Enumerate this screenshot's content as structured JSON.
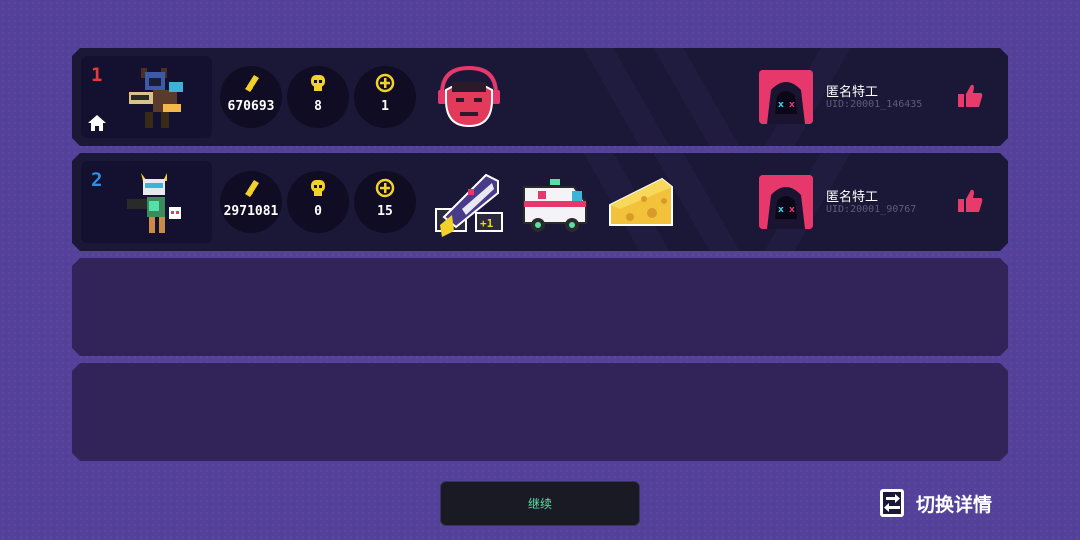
{
  "rows": [
    {
      "rank": "1",
      "rank_color": "#e33a3a",
      "is_self": true,
      "stats": {
        "bullets": "670693",
        "kills": "8",
        "coins": "1"
      },
      "items": [
        "devil-mask-item"
      ],
      "player": {
        "name": "匿名特工",
        "uid": "UID:20001_146435"
      }
    },
    {
      "rank": "2",
      "rank_color": "#2f8fe3",
      "is_self": false,
      "stats": {
        "bullets": "2971081",
        "kills": "0",
        "coins": "15"
      },
      "items": [
        "shark-rocket-item",
        "ambulance-item",
        "cheese-item"
      ],
      "item_badges": {
        "shark_rocket": "+1"
      },
      "player": {
        "name": "匿名特工",
        "uid": "UID:20001_90767"
      }
    }
  ],
  "continue_label": "继续",
  "switch_label": "切换详情",
  "colors": {
    "background": "#54419a",
    "row": "#1b1736",
    "empty_row": "#322358",
    "accent_green": "#54e1a8",
    "gold": "#f2d22a",
    "like_pink": "#e63b6b"
  }
}
